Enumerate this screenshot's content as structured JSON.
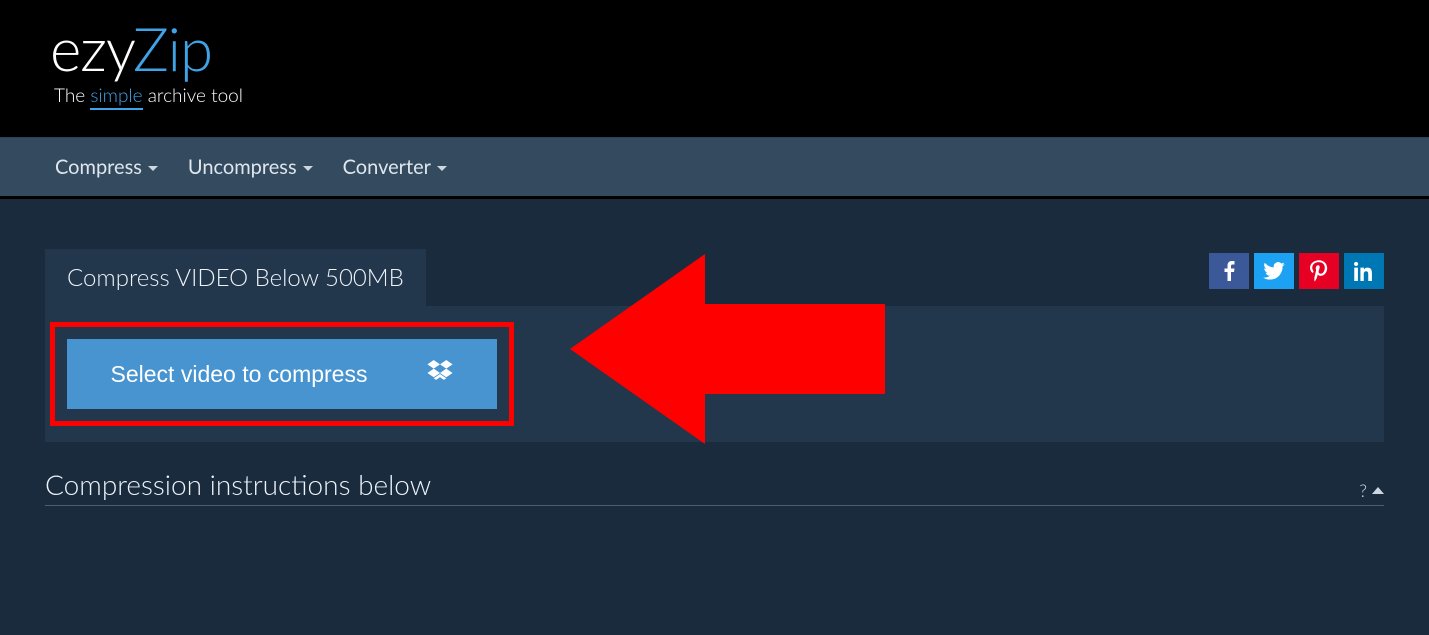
{
  "brand": {
    "part1": "ezy",
    "part2": "Zip",
    "tagline_pre": "The ",
    "tagline_em": "simple",
    "tagline_post": " archive tool"
  },
  "nav": {
    "items": [
      {
        "label": "Compress"
      },
      {
        "label": "Uncompress"
      },
      {
        "label": "Converter"
      }
    ]
  },
  "main": {
    "tab_title": "Compress VIDEO Below 500MB",
    "select_button_label": "Select video to compress",
    "instructions_heading": "Compression instructions below",
    "instructions_toggle_symbol": "?"
  },
  "annotation": {
    "color": "#ff0000"
  },
  "colors": {
    "accent": "#3fa3e8",
    "button": "#4794d0",
    "panel": "#22364c",
    "navbar": "#334a5f",
    "page_bg": "#1a2b3e"
  },
  "share": {
    "facebook": "facebook",
    "twitter": "twitter",
    "pinterest": "pinterest",
    "linkedin": "linkedin"
  }
}
